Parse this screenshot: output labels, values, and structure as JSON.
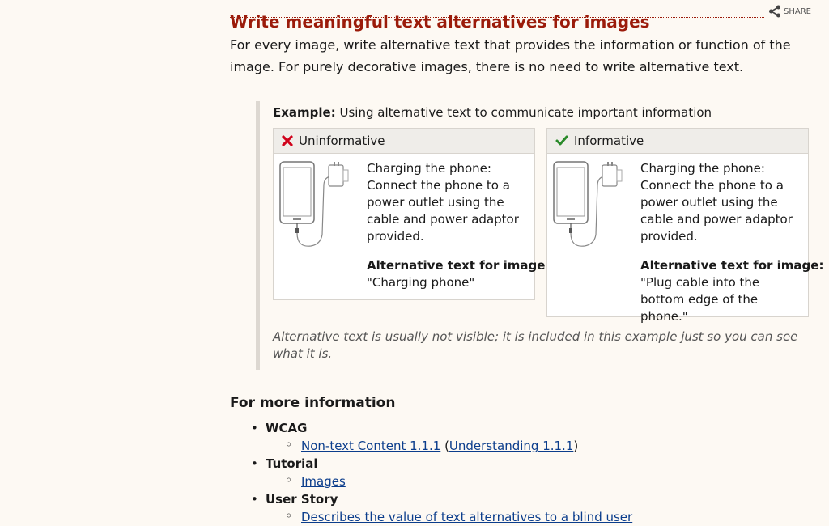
{
  "section": {
    "title": "Write meaningful text alternatives for images",
    "share_label": "SHARE",
    "intro": "For every image, write alternative text that provides the information or function of the image. For purely decorative images, there is no need to write alternative text."
  },
  "example": {
    "label": "Example:",
    "caption": "Using alternative text to communicate important information",
    "cards": [
      {
        "verdict": "Uninformative",
        "icon": "cross-icon",
        "color": "#d0021b",
        "description": "Charging the phone: Connect the phone to a power outlet using the cable and power adaptor provided.",
        "alt_label": "Alternative text for image:",
        "alt_text": "\"Charging phone\""
      },
      {
        "verdict": "Informative",
        "icon": "check-icon",
        "color": "#2a8a2a",
        "description": "Charging the phone: Connect the phone to a power outlet using the cable and power adaptor provided.",
        "alt_label": "Alternative text for image:",
        "alt_text": "\"Plug cable into the bottom edge of the phone.\""
      }
    ],
    "note": "Alternative text is usually not visible; it is included in this example just so you can see what it is."
  },
  "more_info": {
    "title": "For more information",
    "groups": [
      {
        "category": "WCAG",
        "links": [
          "Non-text Content 1.1.1",
          "Understanding 1.1.1"
        ]
      },
      {
        "category": "Tutorial",
        "links": [
          "Images"
        ]
      },
      {
        "category": "User Story",
        "links": [
          "Describes the value of text alternatives to a blind user"
        ]
      }
    ]
  },
  "colors": {
    "heading": "#9b1b0a",
    "link": "#0b3d8c",
    "page_bg": "#fdf9f3"
  }
}
